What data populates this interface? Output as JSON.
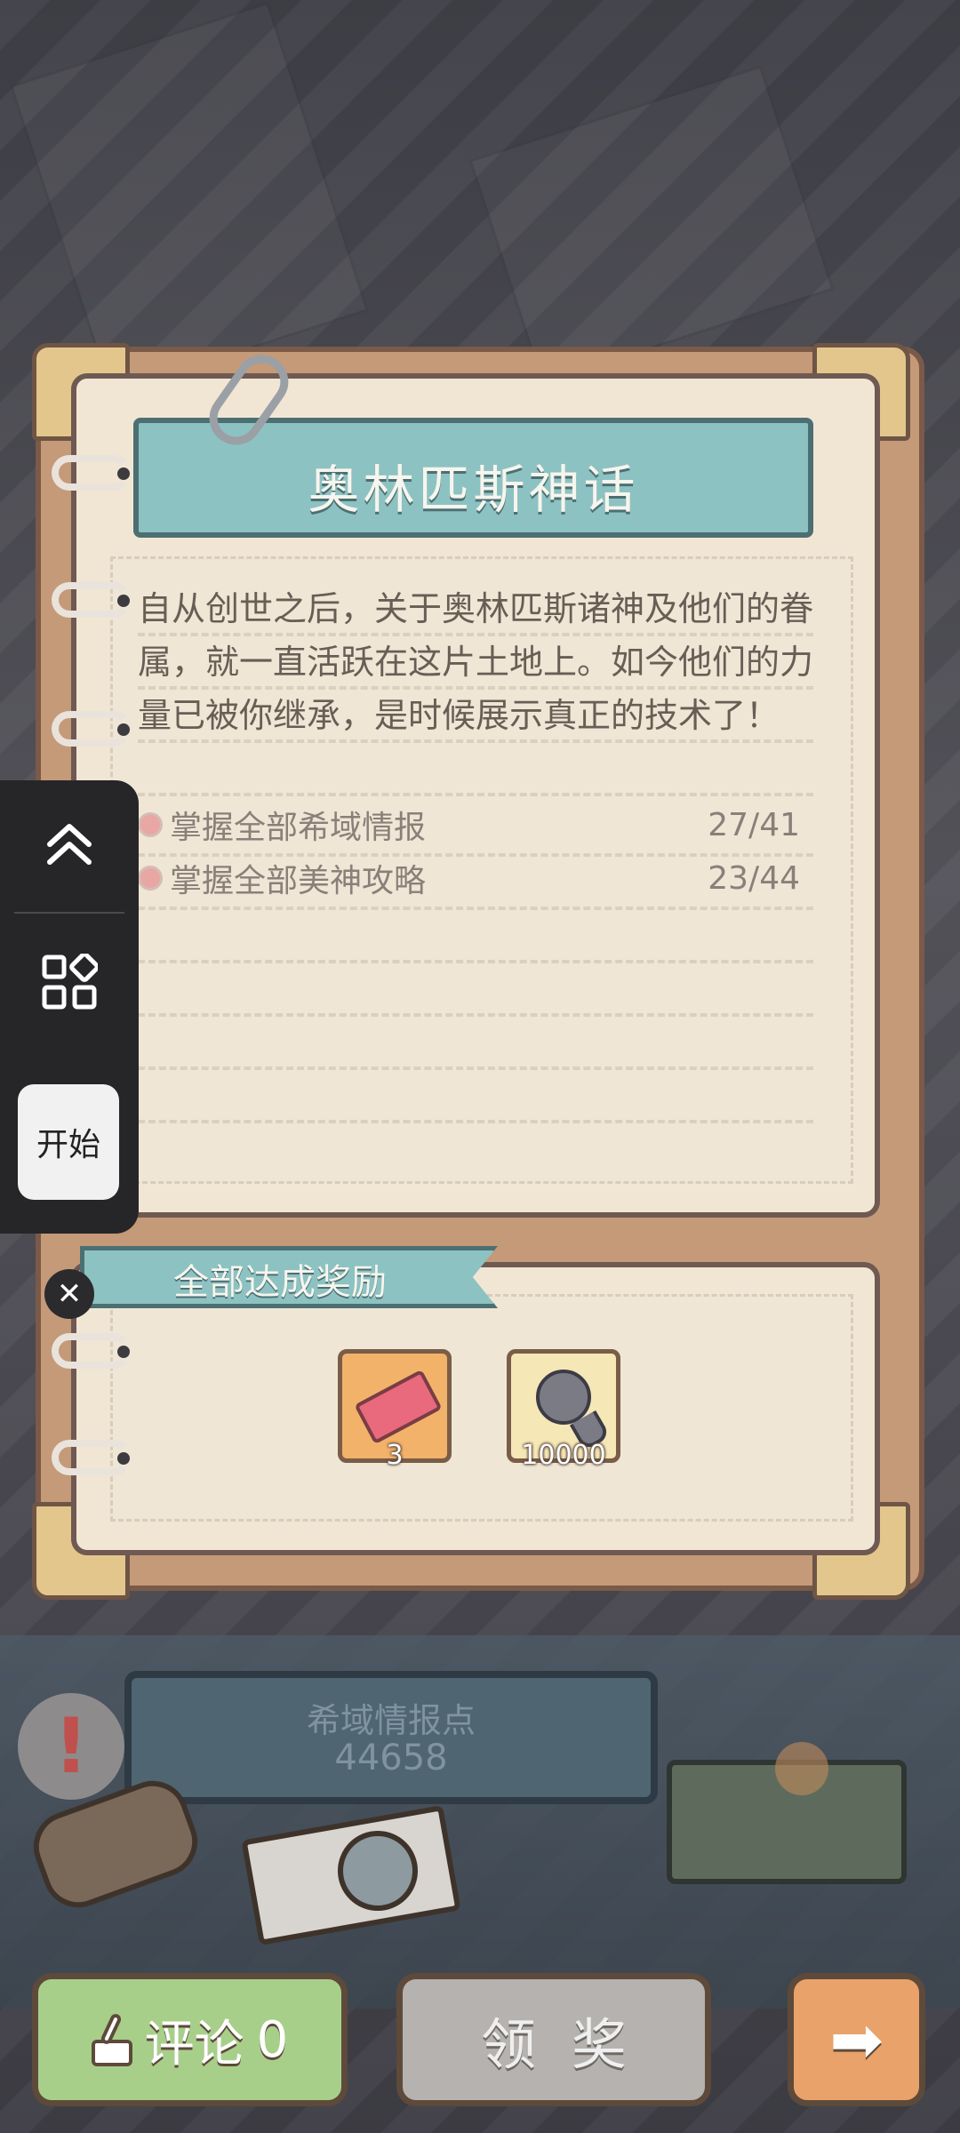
{
  "book": {
    "title": "奥林匹斯神话",
    "description": "自从创世之后，关于奥林匹斯诸神及他们的眷属，就一直活跃在这片土地上。如今他们的力量已被你继承，是时候展示真正的技术了！",
    "tasks": [
      {
        "label": "掌握全部希域情报",
        "count": "27/41"
      },
      {
        "label": "掌握全部美神攻略",
        "count": "23/44"
      }
    ]
  },
  "reward_section": {
    "title": "全部达成奖励",
    "rewards": [
      {
        "icon": "ticket-icon",
        "count": "3"
      },
      {
        "icon": "ghost-icon",
        "count": "10000"
      }
    ]
  },
  "info_sign": {
    "label": "希域情报点",
    "value": "44658"
  },
  "buttons": {
    "comment_label": "评论",
    "comment_count": "0",
    "claim_label": "领奖",
    "next_icon": "arrow-right-icon"
  },
  "side_panel": {
    "start_label": "开始"
  },
  "colors": {
    "banner": "#8dc2c2",
    "page": "#f1e6d4",
    "comment_button": "#a8cf8a",
    "claim_button": "#b5b2af",
    "next_button": "#e8a26a"
  }
}
